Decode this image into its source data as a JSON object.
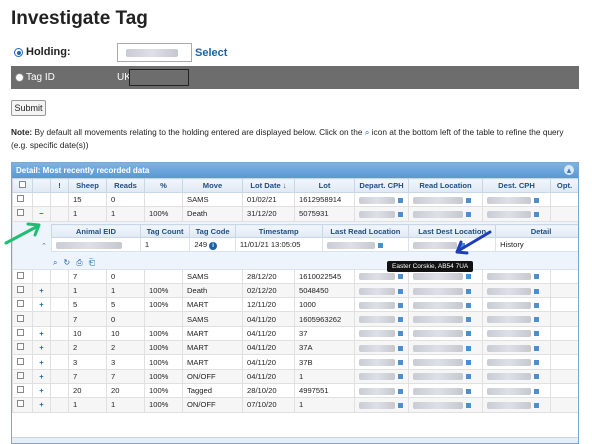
{
  "page": {
    "title": "Investigate Tag"
  },
  "holding": {
    "label": "Holding:",
    "select_label": "Select"
  },
  "tag": {
    "label": "Tag ID",
    "prefix": "UK"
  },
  "submit_label": "Submit",
  "note": {
    "bold": "Note:",
    "text_before": " By default all movements relating to the holding entered are displayed below. Click on the ",
    "text_after": " icon at the bottom left of the table to refine the query (e.g. specific date(s))"
  },
  "grid": {
    "caption": "Detail: Most recently recorded data",
    "columns": [
      "",
      "",
      "!",
      "Sheep",
      "Reads",
      "%",
      "Move",
      "Lot Date ↓",
      "Lot",
      "Depart. CPH",
      "Read Location",
      "Dest. CPH",
      "Opt."
    ],
    "rows": [
      {
        "toggle": "",
        "sheep": "15",
        "reads": "0",
        "pct": "",
        "move": "SAMS",
        "lot_date": "01/02/21",
        "lot": "1612958914"
      },
      {
        "toggle": "−",
        "sheep": "1",
        "reads": "1",
        "pct": "100%",
        "move": "Death",
        "lot_date": "31/12/20",
        "lot": "5075931"
      }
    ],
    "detail": {
      "columns": [
        "Animal EID",
        "Tag Count",
        "Tag Code",
        "Timestamp",
        "Last Read Location",
        "Last Dest Location",
        "Detail"
      ],
      "row": {
        "tag_count": "1",
        "tag_code": "249",
        "timestamp": "11/01/21 13:05:05",
        "detail": "History"
      },
      "tooltip": "Easter Corskie, AB54 7UA"
    },
    "rows_after": [
      {
        "toggle": "",
        "sheep": "7",
        "reads": "0",
        "pct": "",
        "move": "SAMS",
        "lot_date": "28/12/20",
        "lot": "1610022545"
      },
      {
        "toggle": "+",
        "sheep": "1",
        "reads": "1",
        "pct": "100%",
        "move": "Death",
        "lot_date": "02/12/20",
        "lot": "5048450"
      },
      {
        "toggle": "+",
        "sheep": "5",
        "reads": "5",
        "pct": "100%",
        "move": "MART",
        "lot_date": "12/11/20",
        "lot": "1000"
      },
      {
        "toggle": "",
        "sheep": "7",
        "reads": "0",
        "pct": "",
        "move": "SAMS",
        "lot_date": "04/11/20",
        "lot": "1605963262"
      },
      {
        "toggle": "+",
        "sheep": "10",
        "reads": "10",
        "pct": "100%",
        "move": "MART",
        "lot_date": "04/11/20",
        "lot": "37"
      },
      {
        "toggle": "+",
        "sheep": "2",
        "reads": "2",
        "pct": "100%",
        "move": "MART",
        "lot_date": "04/11/20",
        "lot": "37A"
      },
      {
        "toggle": "+",
        "sheep": "3",
        "reads": "3",
        "pct": "100%",
        "move": "MART",
        "lot_date": "04/11/20",
        "lot": "37B"
      },
      {
        "toggle": "+",
        "sheep": "7",
        "reads": "7",
        "pct": "100%",
        "move": "ON/OFF",
        "lot_date": "04/11/20",
        "lot": "1"
      },
      {
        "toggle": "+",
        "sheep": "20",
        "reads": "20",
        "pct": "100%",
        "move": "Tagged",
        "lot_date": "28/10/20",
        "lot": "4997551"
      },
      {
        "toggle": "+",
        "sheep": "1",
        "reads": "1",
        "pct": "100%",
        "move": "ON/OFF",
        "lot_date": "07/10/20",
        "lot": "1"
      }
    ]
  },
  "colors": {
    "accent": "#1b63a6",
    "header": "#5a97d2",
    "annotation_green": "#1fbf73",
    "annotation_blue": "#1f3fb8"
  }
}
